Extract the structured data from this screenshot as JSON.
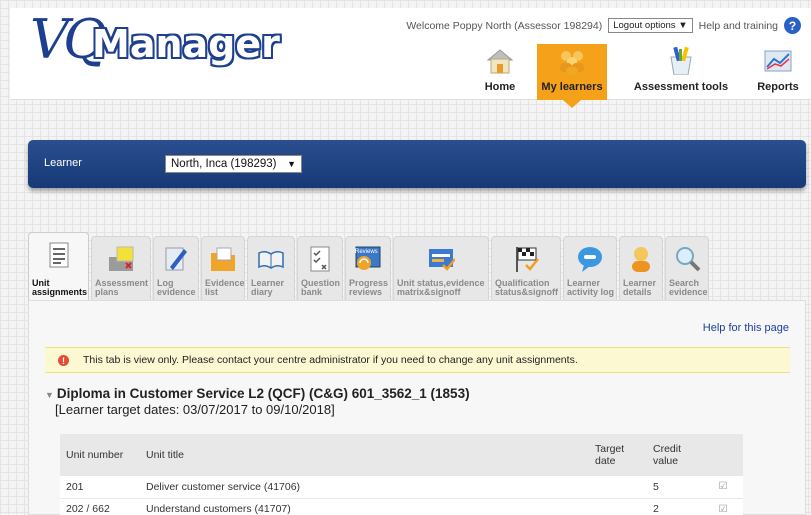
{
  "header": {
    "logo_a": "VQ",
    "logo_b": "Manager",
    "welcome": "Welcome Poppy North (Assessor 198294)",
    "logout": "Logout options",
    "help": "Help and training",
    "nav": [
      {
        "label": "Home",
        "icon": "home-icon"
      },
      {
        "label": "My learners",
        "icon": "learners-icon",
        "active": true
      },
      {
        "label": "Assessment tools",
        "icon": "assessment-tools-icon"
      },
      {
        "label": "Reports",
        "icon": "reports-icon"
      }
    ]
  },
  "learner_bar": {
    "label": "Learner",
    "selected": "North, Inca (198293)"
  },
  "tabs": [
    {
      "label": "Unit assignments",
      "icon": "unit-assignments-icon",
      "active": true
    },
    {
      "label": "Assessment plans",
      "icon": "assessment-plans-icon"
    },
    {
      "label": "Log evidence",
      "icon": "log-evidence-icon"
    },
    {
      "label": "Evidence list",
      "icon": "evidence-list-icon"
    },
    {
      "label": "Learner diary",
      "icon": "learner-diary-icon"
    },
    {
      "label": "Question bank",
      "icon": "question-bank-icon"
    },
    {
      "label": "Progress reviews",
      "icon": "progress-reviews-icon"
    },
    {
      "label": "Unit status,evidence matrix&signoff",
      "icon": "unit-status-icon"
    },
    {
      "label": "Qualification status&signoff",
      "icon": "qualification-status-icon"
    },
    {
      "label": "Learner activity log",
      "icon": "activity-log-icon"
    },
    {
      "label": "Learner details",
      "icon": "learner-details-icon"
    },
    {
      "label": "Search evidence",
      "icon": "search-evidence-icon"
    }
  ],
  "reviews_badge": "Reviews",
  "panel": {
    "help_link": "Help for this page",
    "notice": "This tab is view only. Please contact your centre administrator if you need to change any unit assignments.",
    "qualification": "Diploma in Customer Service L2 (QCF) (C&G) 601_3562_1 (1853)",
    "target_dates": "[Learner target dates: 03/07/2017 to 09/10/2018]",
    "table": {
      "headers": [
        "Unit number",
        "Unit title",
        "Target date",
        "Credit value",
        ""
      ],
      "rows": [
        {
          "unit": "201",
          "title": "Deliver customer service (41706)",
          "target": "",
          "credit": "5",
          "checked": true
        },
        {
          "unit": "202 / 662",
          "title": "Understand customers (41707)",
          "target": "",
          "credit": "2",
          "checked": true
        }
      ]
    }
  },
  "colors": {
    "accent_orange": "#f6a11a",
    "bar_blue": "#1e3f82",
    "link_blue": "#1d3f9a",
    "warn_red": "#e24d36"
  }
}
